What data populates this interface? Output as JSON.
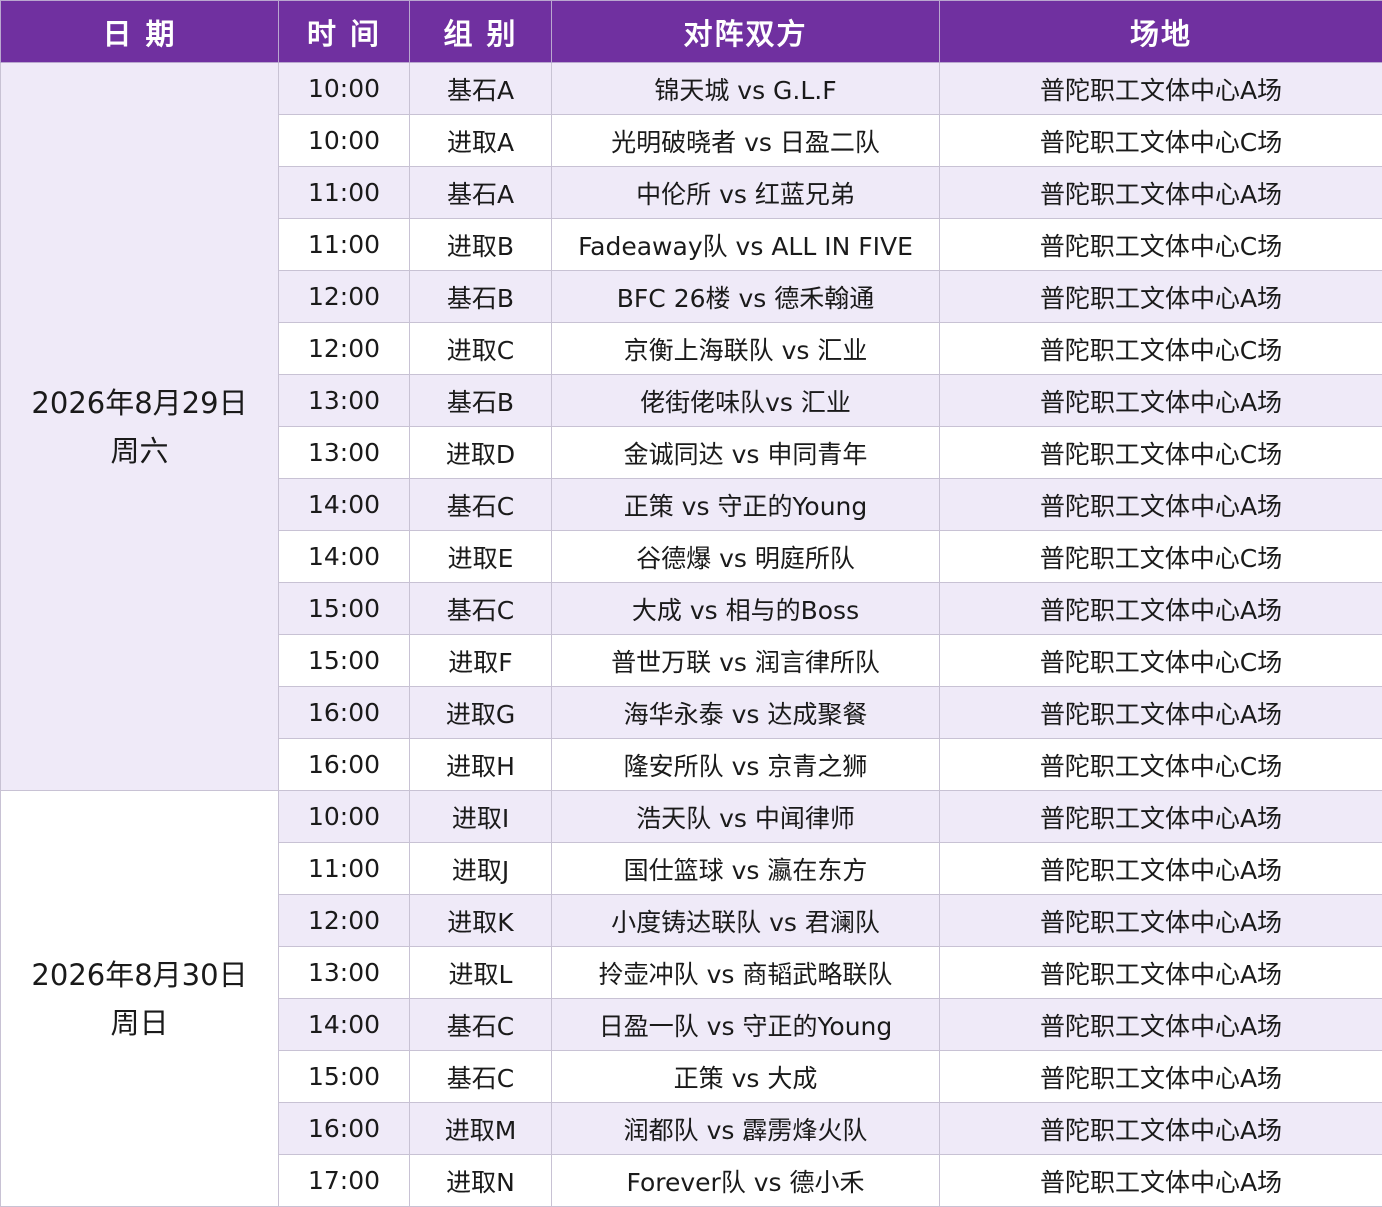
{
  "headers": [
    "日 期",
    "时 间",
    "组 别",
    "对阵双方",
    "场地"
  ],
  "days": [
    {
      "date": "2026年8月29日",
      "weekday": "周六",
      "games": [
        {
          "time": "10:00",
          "group": "基石A",
          "match": "锦天城 vs G.L.F",
          "venue": "普陀职工文体中心A场"
        },
        {
          "time": "10:00",
          "group": "进取A",
          "match": "光明破晓者 vs 日盈二队",
          "venue": "普陀职工文体中心C场"
        },
        {
          "time": "11:00",
          "group": "基石A",
          "match": "中伦所 vs 红蓝兄弟",
          "venue": "普陀职工文体中心A场"
        },
        {
          "time": "11:00",
          "group": "进取B",
          "match": "Fadeaway队 vs ALL IN FIVE",
          "venue": "普陀职工文体中心C场"
        },
        {
          "time": "12:00",
          "group": "基石B",
          "match": "BFC 26楼 vs 德禾翰通",
          "venue": "普陀职工文体中心A场"
        },
        {
          "time": "12:00",
          "group": "进取C",
          "match": "京衡上海联队 vs 汇业",
          "venue": "普陀职工文体中心C场"
        },
        {
          "time": "13:00",
          "group": "基石B",
          "match": "佬街佬味队vs 汇业",
          "venue": "普陀职工文体中心A场"
        },
        {
          "time": "13:00",
          "group": "进取D",
          "match": "金诚同达 vs 申同青年",
          "venue": "普陀职工文体中心C场"
        },
        {
          "time": "14:00",
          "group": "基石C",
          "match": "正策 vs 守正的Young",
          "venue": "普陀职工文体中心A场"
        },
        {
          "time": "14:00",
          "group": "进取E",
          "match": "谷德爆 vs 明庭所队",
          "venue": "普陀职工文体中心C场"
        },
        {
          "time": "15:00",
          "group": "基石C",
          "match": "大成 vs 相与的Boss",
          "venue": "普陀职工文体中心A场"
        },
        {
          "time": "15:00",
          "group": "进取F",
          "match": "普世万联 vs 润言律所队",
          "venue": "普陀职工文体中心C场"
        },
        {
          "time": "16:00",
          "group": "进取G",
          "match": "海华永泰 vs 达成聚餐",
          "venue": "普陀职工文体中心A场"
        },
        {
          "time": "16:00",
          "group": "进取H",
          "match": "隆安所队 vs 京青之狮",
          "venue": "普陀职工文体中心C场"
        }
      ]
    },
    {
      "date": "2026年8月30日",
      "weekday": "周日",
      "games": [
        {
          "time": "10:00",
          "group": "进取I",
          "match": "浩天队 vs 中闻律师",
          "venue": "普陀职工文体中心A场"
        },
        {
          "time": "11:00",
          "group": "进取J",
          "match": "国仕篮球 vs 瀛在东方",
          "venue": "普陀职工文体中心A场"
        },
        {
          "time": "12:00",
          "group": "进取K",
          "match": "小度铸达联队 vs 君澜队",
          "venue": "普陀职工文体中心A场"
        },
        {
          "time": "13:00",
          "group": "进取L",
          "match": "拎壶冲队 vs 商韬武略联队",
          "venue": "普陀职工文体中心A场"
        },
        {
          "time": "14:00",
          "group": "基石C",
          "match": "日盈一队 vs 守正的Young",
          "venue": "普陀职工文体中心A场"
        },
        {
          "time": "15:00",
          "group": "基石C",
          "match": "正策 vs 大成",
          "venue": "普陀职工文体中心A场"
        },
        {
          "time": "16:00",
          "group": "进取M",
          "match": "润都队 vs 霹雳烽火队",
          "venue": "普陀职工文体中心A场"
        },
        {
          "time": "17:00",
          "group": "进取N",
          "match": "Forever队 vs 德小禾",
          "venue": "普陀职工文体中心A场"
        }
      ]
    }
  ]
}
